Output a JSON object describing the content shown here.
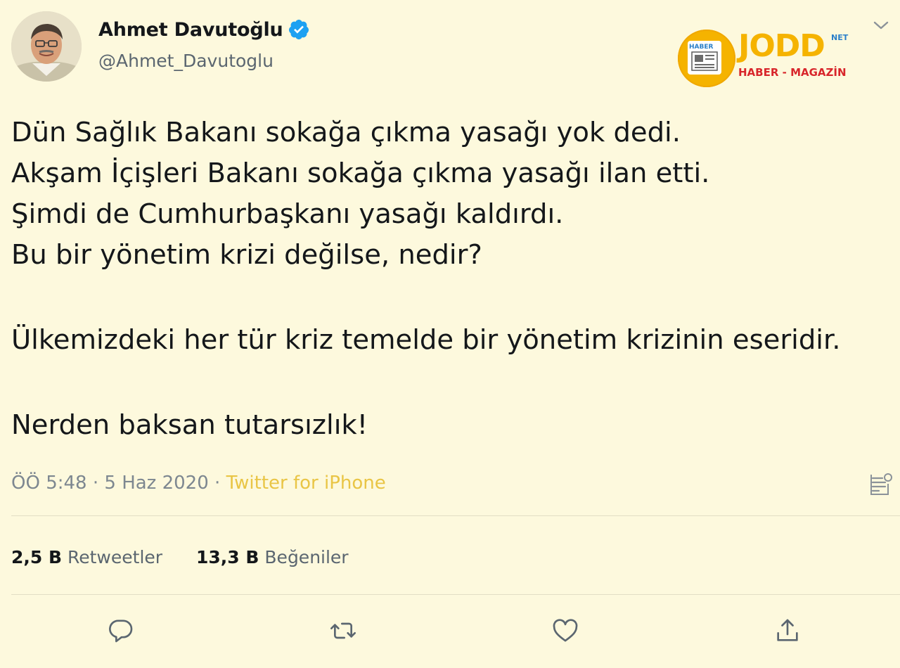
{
  "author": {
    "display_name": "Ahmet Davutoğlu",
    "handle": "@Ahmet_Davutoglu",
    "verified": true
  },
  "watermark": {
    "brand": "JODD",
    "suffix": "NET",
    "tagline": "HABER - MAGAZİN",
    "badge": "HABER",
    "colors": {
      "primary": "#f5b300",
      "accent": "#2a7fc9",
      "tagline": "#d8262b"
    }
  },
  "tweet": {
    "lines": [
      "Dün Sağlık Bakanı sokağa çıkma yasağı yok dedi.",
      "Akşam İçişleri Bakanı sokağa çıkma yasağı ilan etti.",
      "Şimdi de Cumhurbaşkanı yasağı kaldırdı.",
      "Bu bir yönetim krizi değilse, nedir?",
      "Ülkemizdeki her tür kriz temelde bir yönetim krizinin eseridir.",
      "Nerden baksan tutarsızlık!"
    ]
  },
  "meta": {
    "time": "ÖÖ 5:48",
    "separator": "·",
    "date": "5 Haz 2020",
    "source": "Twitter for iPhone"
  },
  "stats": {
    "retweets_count": "2,5 B",
    "retweets_label": "Retweetler",
    "likes_count": "13,3 B",
    "likes_label": "Beğeniler"
  },
  "icons": {
    "reply": "reply-icon",
    "retweet": "retweet-icon",
    "like": "heart-icon",
    "share": "share-icon",
    "more": "chevron-down-icon",
    "analytics": "analytics-icon",
    "verified": "verified-badge-icon"
  },
  "colors": {
    "background": "#fdf9dd",
    "verified": "#1da1f2",
    "source_link": "#e9c545",
    "secondary_text": "#5b6670"
  }
}
